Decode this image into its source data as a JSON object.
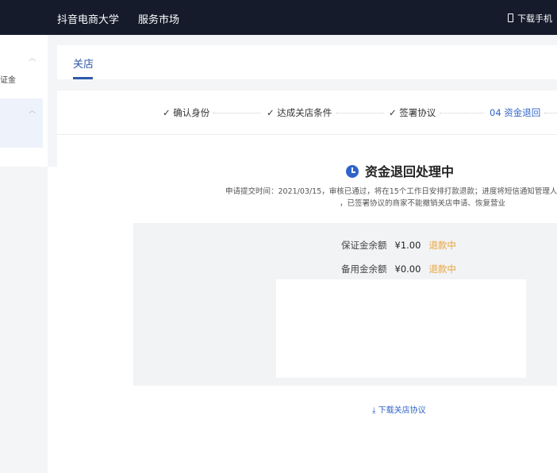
{
  "header": {
    "nav": [
      "抖音电商大学",
      "服务市场"
    ],
    "download": "下载手机"
  },
  "sidebar": {
    "item_partial": "证金"
  },
  "tabs": [
    {
      "label": "关店",
      "active": true
    }
  ],
  "steps": [
    {
      "label": "确认身份",
      "done": true
    },
    {
      "label": "达成关店条件",
      "done": true
    },
    {
      "label": "签署协议",
      "done": true
    },
    {
      "label": "04 资金退回",
      "current": true
    }
  ],
  "status": {
    "title": "资金退回处理中",
    "desc_line1": "申请提交时间：2021/03/15，审核已通过，将在15个工作日安排打款退款；进度将短信通知管理人",
    "desc_line2": "，已签署协议的商家不能撤销关店申请、恢复营业"
  },
  "balances": [
    {
      "label": "保证金余额",
      "amount": "¥1.00",
      "status": "退款中"
    },
    {
      "label": "备用金余额",
      "amount": "¥0.00",
      "status": "退款中"
    }
  ],
  "download_agreement": "下载关店协议",
  "colors": {
    "accent": "#2f64c8",
    "warning": "#e8a43a",
    "header_bg": "#151b2b"
  }
}
